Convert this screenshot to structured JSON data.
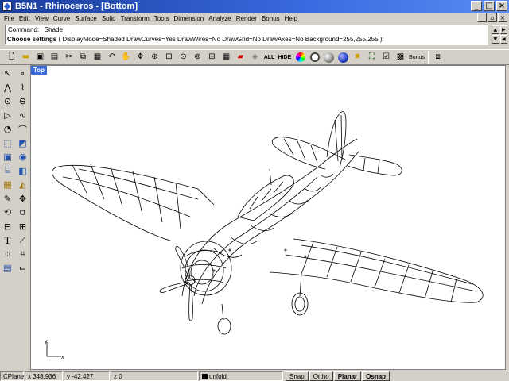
{
  "window": {
    "title": "B5N1 - Rhinoceros - [Bottom]",
    "buttons": [
      "_",
      "□",
      "×"
    ]
  },
  "menu": {
    "items": [
      "File",
      "Edit",
      "View",
      "Curve",
      "Surface",
      "Solid",
      "Transform",
      "Tools",
      "Dimension",
      "Analyze",
      "Render",
      "Bonus",
      "Help"
    ],
    "window_buttons": [
      "_",
      "▫",
      "×"
    ]
  },
  "command": {
    "history": "Command: _Shade",
    "prompt_label": "Choose settings",
    "prompt_options": "( DisplayMode=Shaded  DrawCurves=Yes  DrawWires=No  DrawGrid=No  DrawAxes=No  Background=255,255,255 ):"
  },
  "toolbar": {
    "icons": [
      "new-file-icon",
      "open-icon",
      "save-icon",
      "save-small-icon",
      "cut-icon",
      "copy-icon",
      "paste-icon",
      "undo-icon",
      "pan-hand-icon",
      "rotate-view-icon",
      "zoom-dynamic-icon",
      "zoom-window-icon",
      "zoom-extents-icon",
      "zoom-selected-icon",
      "4-view-icon",
      "grid-icon",
      "car-icon",
      "render-setup-icon",
      "show-all-icon",
      "hide-icon",
      "color-wheel-icon",
      "render-icon",
      "ghosted-icon",
      "shaded-sphere-icon",
      "light-icon",
      "dimension-icon",
      "check-icon",
      "properties-icon"
    ],
    "all_label": "ALL",
    "hide_label": "HIDE",
    "bonus_label": "Bonus"
  },
  "left_toolbar": {
    "icons": [
      "select-arrow-icon",
      "point-icon",
      "polyline-icon",
      "control-points-icon",
      "circle-icon",
      "ellipse-icon",
      "polygon-icon",
      "curve-icon",
      "arc-icon",
      "fillet-icon",
      "extrude-icon",
      "surface-corners-icon",
      "box-icon",
      "sphere-icon",
      "cylinder-icon",
      "boolean-icon",
      "mesh-icon",
      "solid-ops-icon",
      "edit-icon",
      "move-icon",
      "rotate-icon",
      "scale-icon",
      "mirror-icon",
      "array-icon",
      "text-icon",
      "dim-icon",
      "group-icon",
      "block-icon",
      "layer-icon",
      "analyze-icon"
    ]
  },
  "viewport": {
    "label": "Top",
    "axis_x": "x",
    "axis_y": "y"
  },
  "status": {
    "cplane": "CPlane",
    "x": "x 348.936",
    "y": "y -42.427",
    "z": "z 0",
    "layer": "unfold",
    "snap": "Snap",
    "ortho": "Ortho",
    "planar": "Planar",
    "osnap": "Osnap"
  }
}
